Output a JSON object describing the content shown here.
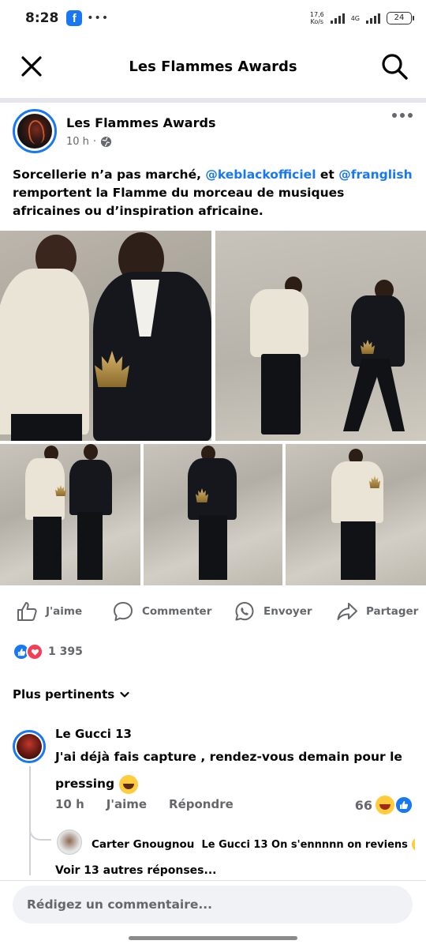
{
  "status_bar": {
    "time": "8:28",
    "app_badge": "f",
    "dots": "•••",
    "net_speed_value": "17,6",
    "net_speed_unit": "Ko/s",
    "network": "4G",
    "battery": "24"
  },
  "header": {
    "title": "Les Flammes Awards"
  },
  "post": {
    "page_name": "Les Flammes Awards",
    "time": "10 h",
    "separator": "·",
    "text_part1": "Sorcellerie n’a pas marché, ",
    "mention1": "@keblackofficiel",
    "text_part2": " et ",
    "mention2": "@franglish",
    "text_part3": " remportent la Flamme du morceau de musiques africaines ou d’inspiration africaine."
  },
  "actions": {
    "like": "J'aime",
    "comment": "Commenter",
    "send": "Envoyer",
    "share": "Partager"
  },
  "reactions": {
    "count": "1 395"
  },
  "sort": {
    "label": "Plus pertinents"
  },
  "comment": {
    "author": "Le Gucci 13",
    "text": "J'ai déjà fais capture , rendez-vous demain pour le pressing",
    "time": "10 h",
    "like": "J'aime",
    "reply": "Répondre",
    "reaction_count": "66"
  },
  "reply": {
    "author": "Carter Gnougnou",
    "text": "Le Gucci 13 On s'ennnnn on reviens",
    "ellipsis": "..."
  },
  "more_replies": "Voir 13 autres réponses...",
  "comment_input": {
    "placeholder": "Rédigez un commentaire..."
  },
  "colors": {
    "brand": "#1877f2",
    "love": "#f33e58",
    "muted": "#65676b"
  }
}
